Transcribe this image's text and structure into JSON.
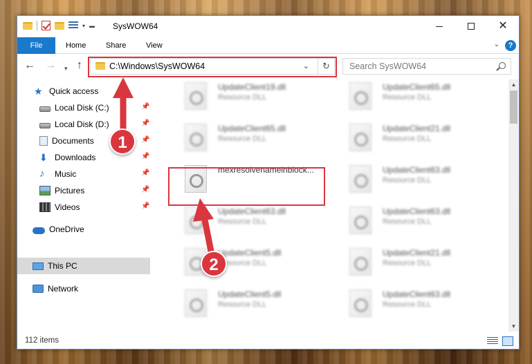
{
  "window": {
    "title": "SysWOW64",
    "controls": {
      "minimize": "—",
      "maximize": "☐",
      "close": "✕"
    }
  },
  "ribbon": {
    "tabs": [
      "File",
      "Home",
      "Share",
      "View"
    ],
    "help": "?"
  },
  "address_bar": {
    "path": "C:\\Windows\\SysWOW64",
    "refresh_glyph": "↻",
    "dropdown_glyph": "⌄"
  },
  "search": {
    "placeholder": "Search SysWOW64"
  },
  "nav_pane": {
    "quick_access": "Quick access",
    "items": [
      {
        "label": "Local Disk (C:)",
        "icon": "disk-icon",
        "pinned": true
      },
      {
        "label": "Local Disk (D:)",
        "icon": "disk-icon",
        "pinned": true
      },
      {
        "label": "Documents",
        "icon": "documents-icon",
        "pinned": true
      },
      {
        "label": "Downloads",
        "icon": "downloads-icon",
        "pinned": true
      },
      {
        "label": "Music",
        "icon": "music-icon",
        "pinned": true
      },
      {
        "label": "Pictures",
        "icon": "pictures-icon",
        "pinned": true
      },
      {
        "label": "Videos",
        "icon": "videos-icon",
        "pinned": true
      }
    ],
    "onedrive": "OneDrive",
    "this_pc": "This PC",
    "network": "Network"
  },
  "files": {
    "left_column": [
      {
        "name": "UpdateClient19.dll",
        "type": "Resource DLL"
      },
      {
        "name": "UpdateClient65.dll",
        "type": "Resource DLL"
      },
      {
        "name": "mexresolvenameinblock...",
        "type": ""
      },
      {
        "name": "UpdateClient63.dll",
        "type": "Resource DLL"
      },
      {
        "name": "UpdateClient5.dll",
        "type": "Resource DLL"
      },
      {
        "name": "UpdateClient5.dll",
        "type": "Resource DLL"
      }
    ],
    "right_column": [
      {
        "name": "UpdateClient65.dll",
        "type": "Resource DLL"
      },
      {
        "name": "UpdateClient21.dll",
        "type": "Resource DLL"
      },
      {
        "name": "UpdateClient63.dll",
        "type": "Resource DLL"
      },
      {
        "name": "UpdateClient63.dll",
        "type": "Resource DLL"
      },
      {
        "name": "UpdateClient21.dll",
        "type": "Resource DLL"
      },
      {
        "name": "UpdateClient63.dll",
        "type": "Resource DLL"
      }
    ]
  },
  "status": {
    "item_count": "112 items"
  },
  "annotations": {
    "step1": "1",
    "step2": "2"
  },
  "colors": {
    "accent": "#1979ca",
    "highlight": "#d9363e",
    "selection": "#d9d9d9"
  }
}
